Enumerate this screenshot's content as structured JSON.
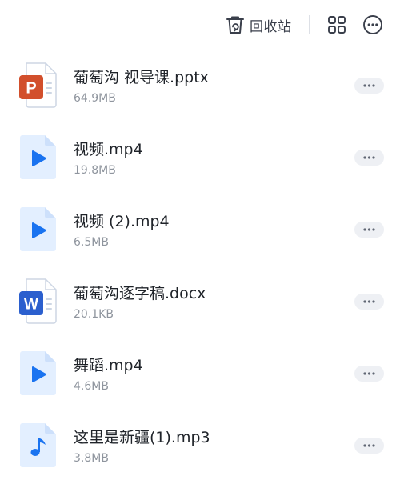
{
  "toolbar": {
    "recycle_label": "回收站",
    "recycle_icon": "trash-bin-icon",
    "grid_icon": "grid-view-icon",
    "more_icon": "more-options-icon"
  },
  "colors": {
    "ppt_red": "#d24f2c",
    "word_blue": "#2b5fce",
    "media_tile": "#e3efff",
    "media_glyph": "#1a73f0",
    "text_primary": "#1f2329",
    "text_secondary": "#8f959e",
    "pill_bg": "#eef0f4"
  },
  "files": [
    {
      "name": "葡萄沟 视导课.pptx",
      "size": "64.9MB",
      "type": "pptx",
      "badge": "P",
      "icon": "powerpoint-file-icon"
    },
    {
      "name": "视频.mp4",
      "size": "19.8MB",
      "type": "video",
      "icon": "video-file-icon"
    },
    {
      "name": "视频 (2).mp4",
      "size": "6.5MB",
      "type": "video",
      "icon": "video-file-icon"
    },
    {
      "name": "葡萄沟逐字稿.docx",
      "size": "20.1KB",
      "type": "docx",
      "badge": "W",
      "icon": "word-file-icon"
    },
    {
      "name": "舞蹈.mp4",
      "size": "4.6MB",
      "type": "video",
      "icon": "video-file-icon"
    },
    {
      "name": "这里是新疆(1).mp3",
      "size": "3.8MB",
      "type": "audio",
      "icon": "audio-file-icon"
    }
  ]
}
